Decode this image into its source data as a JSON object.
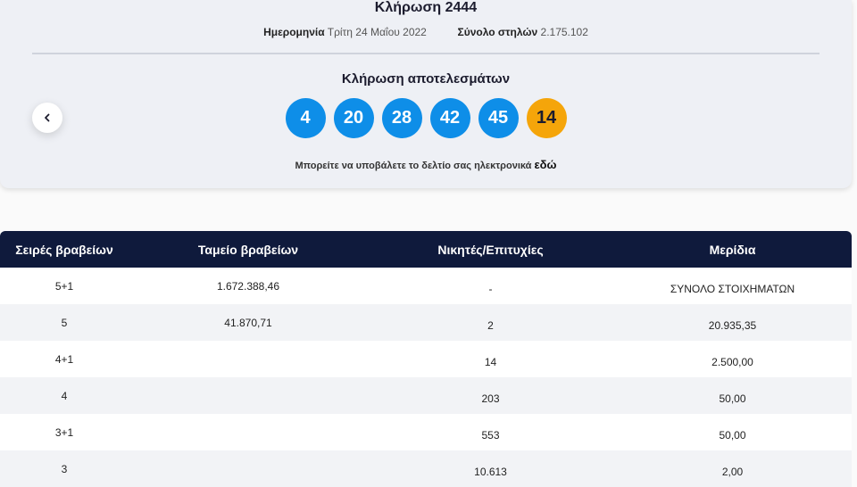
{
  "draw": {
    "title": "Κλήρωση 2444",
    "date_label": "Ημερομηνία",
    "date_value": "Τρίτη 24 Μαΐου 2022",
    "columns_label": "Σύνολο στηλών",
    "columns_value": "2.175.102"
  },
  "results": {
    "title": "Κλήρωση αποτελεσμάτων",
    "numbers": [
      "4",
      "20",
      "28",
      "42",
      "45"
    ],
    "joker": "14",
    "ball_color": "#0e8ee8",
    "joker_color": "#f5a50a"
  },
  "submit": {
    "text": "Μπορείτε να υποβάλετε το δελτίο σας ηλεκτρονικά",
    "link": "εδώ"
  },
  "nav": {
    "prev_icon": "chevron-left-icon"
  },
  "table": {
    "headers": [
      "Σειρές βραβείων",
      "Ταμείο βραβείων",
      "Νικητές/Επιτυχίες",
      "Μερίδια"
    ],
    "rows": [
      [
        "5+1",
        "1.672.388,46",
        "-",
        "ΣΥΝΟΛΟ ΣΤΟΙΧΗΜΑΤΩΝ"
      ],
      [
        "5",
        "41.870,71",
        "2",
        "20.935,35"
      ],
      [
        "4+1",
        "",
        "14",
        "2.500,00"
      ],
      [
        "4",
        "",
        "203",
        "50,00"
      ],
      [
        "3+1",
        "",
        "553",
        "50,00"
      ],
      [
        "3",
        "",
        "10.613",
        "2,00"
      ]
    ],
    "header_bg": "#0f1a3c"
  }
}
